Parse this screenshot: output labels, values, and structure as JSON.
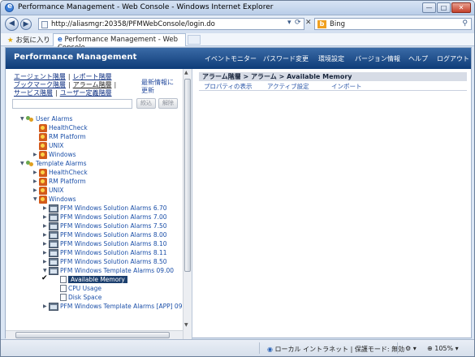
{
  "window": {
    "title": "Performance Management - Web Console - Windows Internet Explorer",
    "controls": [
      "—",
      "□",
      "✕"
    ]
  },
  "address_bar": {
    "url": "http://aliasmgr:20358/PFMWebConsole/login.do",
    "search_value": "Bing",
    "back_icon": "back-arrow-icon",
    "forward_icon": "forward-arrow-icon"
  },
  "favorites_bar": {
    "favorites_label": "お気に入り",
    "tab_label": "Performance Management - Web Console"
  },
  "header": {
    "brand": "Performance Management",
    "menu": [
      "イベントモニター",
      "パスワード変更",
      "環境設定",
      "バージョン情報",
      "ヘルプ",
      "ログアウト"
    ]
  },
  "left_panel": {
    "links_row1": [
      "エージェント階層",
      "レポート階層"
    ],
    "links_row2": [
      "ブックマーク階層",
      "アラーム階層"
    ],
    "links_row3": [
      "サービス階層",
      "ユーザー定義階層"
    ],
    "refresh_label": "最新情報に更新",
    "filter_value": "",
    "narrow_button": "絞込",
    "clear_button": "解除"
  },
  "tree": [
    {
      "label": "User Alarms",
      "level": 0,
      "icon": "alarm-group-icon",
      "expander": "▼"
    },
    {
      "label": "HealthCheck",
      "level": 1,
      "icon": "alarm-bell-icon",
      "expander": ""
    },
    {
      "label": "RM Platform",
      "level": 1,
      "icon": "alarm-bell-icon",
      "expander": ""
    },
    {
      "label": "UNIX",
      "level": 1,
      "icon": "alarm-bell-icon",
      "expander": ""
    },
    {
      "label": "Windows",
      "level": 1,
      "icon": "alarm-bell-icon",
      "expander": "▶"
    },
    {
      "label": "Template Alarms",
      "level": 0,
      "icon": "alarm-group-icon",
      "expander": "▼"
    },
    {
      "label": "HealthCheck",
      "level": 1,
      "icon": "alarm-bell-icon",
      "expander": "▶"
    },
    {
      "label": "RM Platform",
      "level": 1,
      "icon": "alarm-bell-icon",
      "expander": "▶"
    },
    {
      "label": "UNIX",
      "level": 1,
      "icon": "alarm-bell-icon",
      "expander": "▶"
    },
    {
      "label": "Windows",
      "level": 1,
      "icon": "alarm-bell-icon",
      "expander": "▼"
    },
    {
      "label": "PFM Windows Solution Alarms 6.70",
      "level": 2,
      "icon": "alarm-table-icon",
      "expander": "▶"
    },
    {
      "label": "PFM Windows Solution Alarms 7.00",
      "level": 2,
      "icon": "alarm-table-icon",
      "expander": "▶"
    },
    {
      "label": "PFM Windows Solution Alarms 7.50",
      "level": 2,
      "icon": "alarm-table-icon",
      "expander": "▶"
    },
    {
      "label": "PFM Windows Solution Alarms 8.00",
      "level": 2,
      "icon": "alarm-table-icon",
      "expander": "▶"
    },
    {
      "label": "PFM Windows Solution Alarms 8.10",
      "level": 2,
      "icon": "alarm-table-icon",
      "expander": "▶"
    },
    {
      "label": "PFM Windows Solution Alarms 8.11",
      "level": 2,
      "icon": "alarm-table-icon",
      "expander": "▶"
    },
    {
      "label": "PFM Windows Solution Alarms 8.50",
      "level": 2,
      "icon": "alarm-table-icon",
      "expander": "▶"
    },
    {
      "label": "PFM Windows Template Alarms 09.00",
      "level": 2,
      "icon": "alarm-table-icon",
      "expander": "▼"
    },
    {
      "label": "Available Memory",
      "level": 3,
      "icon": "alarm-doc-icon",
      "expander": "",
      "selected": true,
      "checked": true
    },
    {
      "label": "CPU Usage",
      "level": 3,
      "icon": "alarm-doc-icon",
      "expander": ""
    },
    {
      "label": "Disk Space",
      "level": 3,
      "icon": "alarm-doc-icon",
      "expander": ""
    },
    {
      "label": "PFM Windows Template Alarms [APP] 09",
      "level": 2,
      "icon": "alarm-table-icon",
      "expander": "▶"
    }
  ],
  "right_panel": {
    "breadcrumb": "アラーム階層 > アラーム > Available Memory",
    "tabs": [
      "プロパティの表示",
      "アクティブ設定",
      "インポート"
    ]
  },
  "status_bar": {
    "zone": "ローカル イントラネット | 保護モード: 無効",
    "zoom": "105%"
  },
  "colors": {
    "header_bg": "#0e3c78",
    "link": "#1b4fa8",
    "selection": "#1c3f6e"
  }
}
